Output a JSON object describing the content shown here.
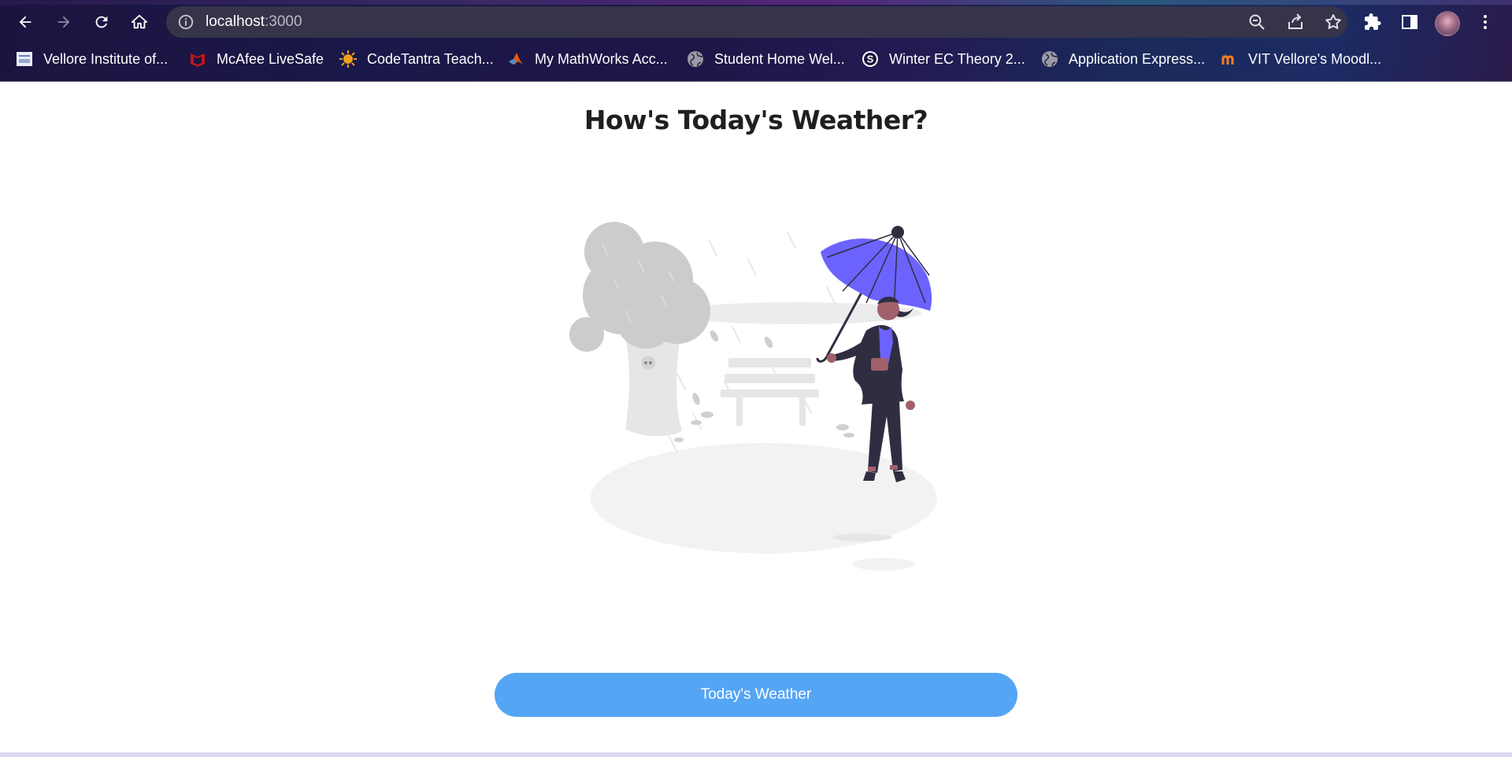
{
  "browser": {
    "url_host": "localhost",
    "url_port": ":3000",
    "bookmarks": [
      {
        "label": "Vellore Institute of...",
        "icon": "vit-icon"
      },
      {
        "label": "McAfee LiveSafe",
        "icon": "mcafee-icon"
      },
      {
        "label": "CodeTantra Teach...",
        "icon": "codetantra-icon"
      },
      {
        "label": "My MathWorks Acc...",
        "icon": "mathworks-icon"
      },
      {
        "label": "Student Home Wel...",
        "icon": "globe-icon"
      },
      {
        "label": "Winter EC Theory 2...",
        "icon": "s-circle-icon"
      },
      {
        "label": "Application Express...",
        "icon": "globe-icon"
      },
      {
        "label": "VIT Vellore's Moodl...",
        "icon": "moodle-icon"
      }
    ]
  },
  "page": {
    "title": "How's Today's Weather?",
    "button_label": "Today's Weather"
  },
  "colors": {
    "accent": "#55a5f5",
    "umbrella": "#6c63ff"
  }
}
